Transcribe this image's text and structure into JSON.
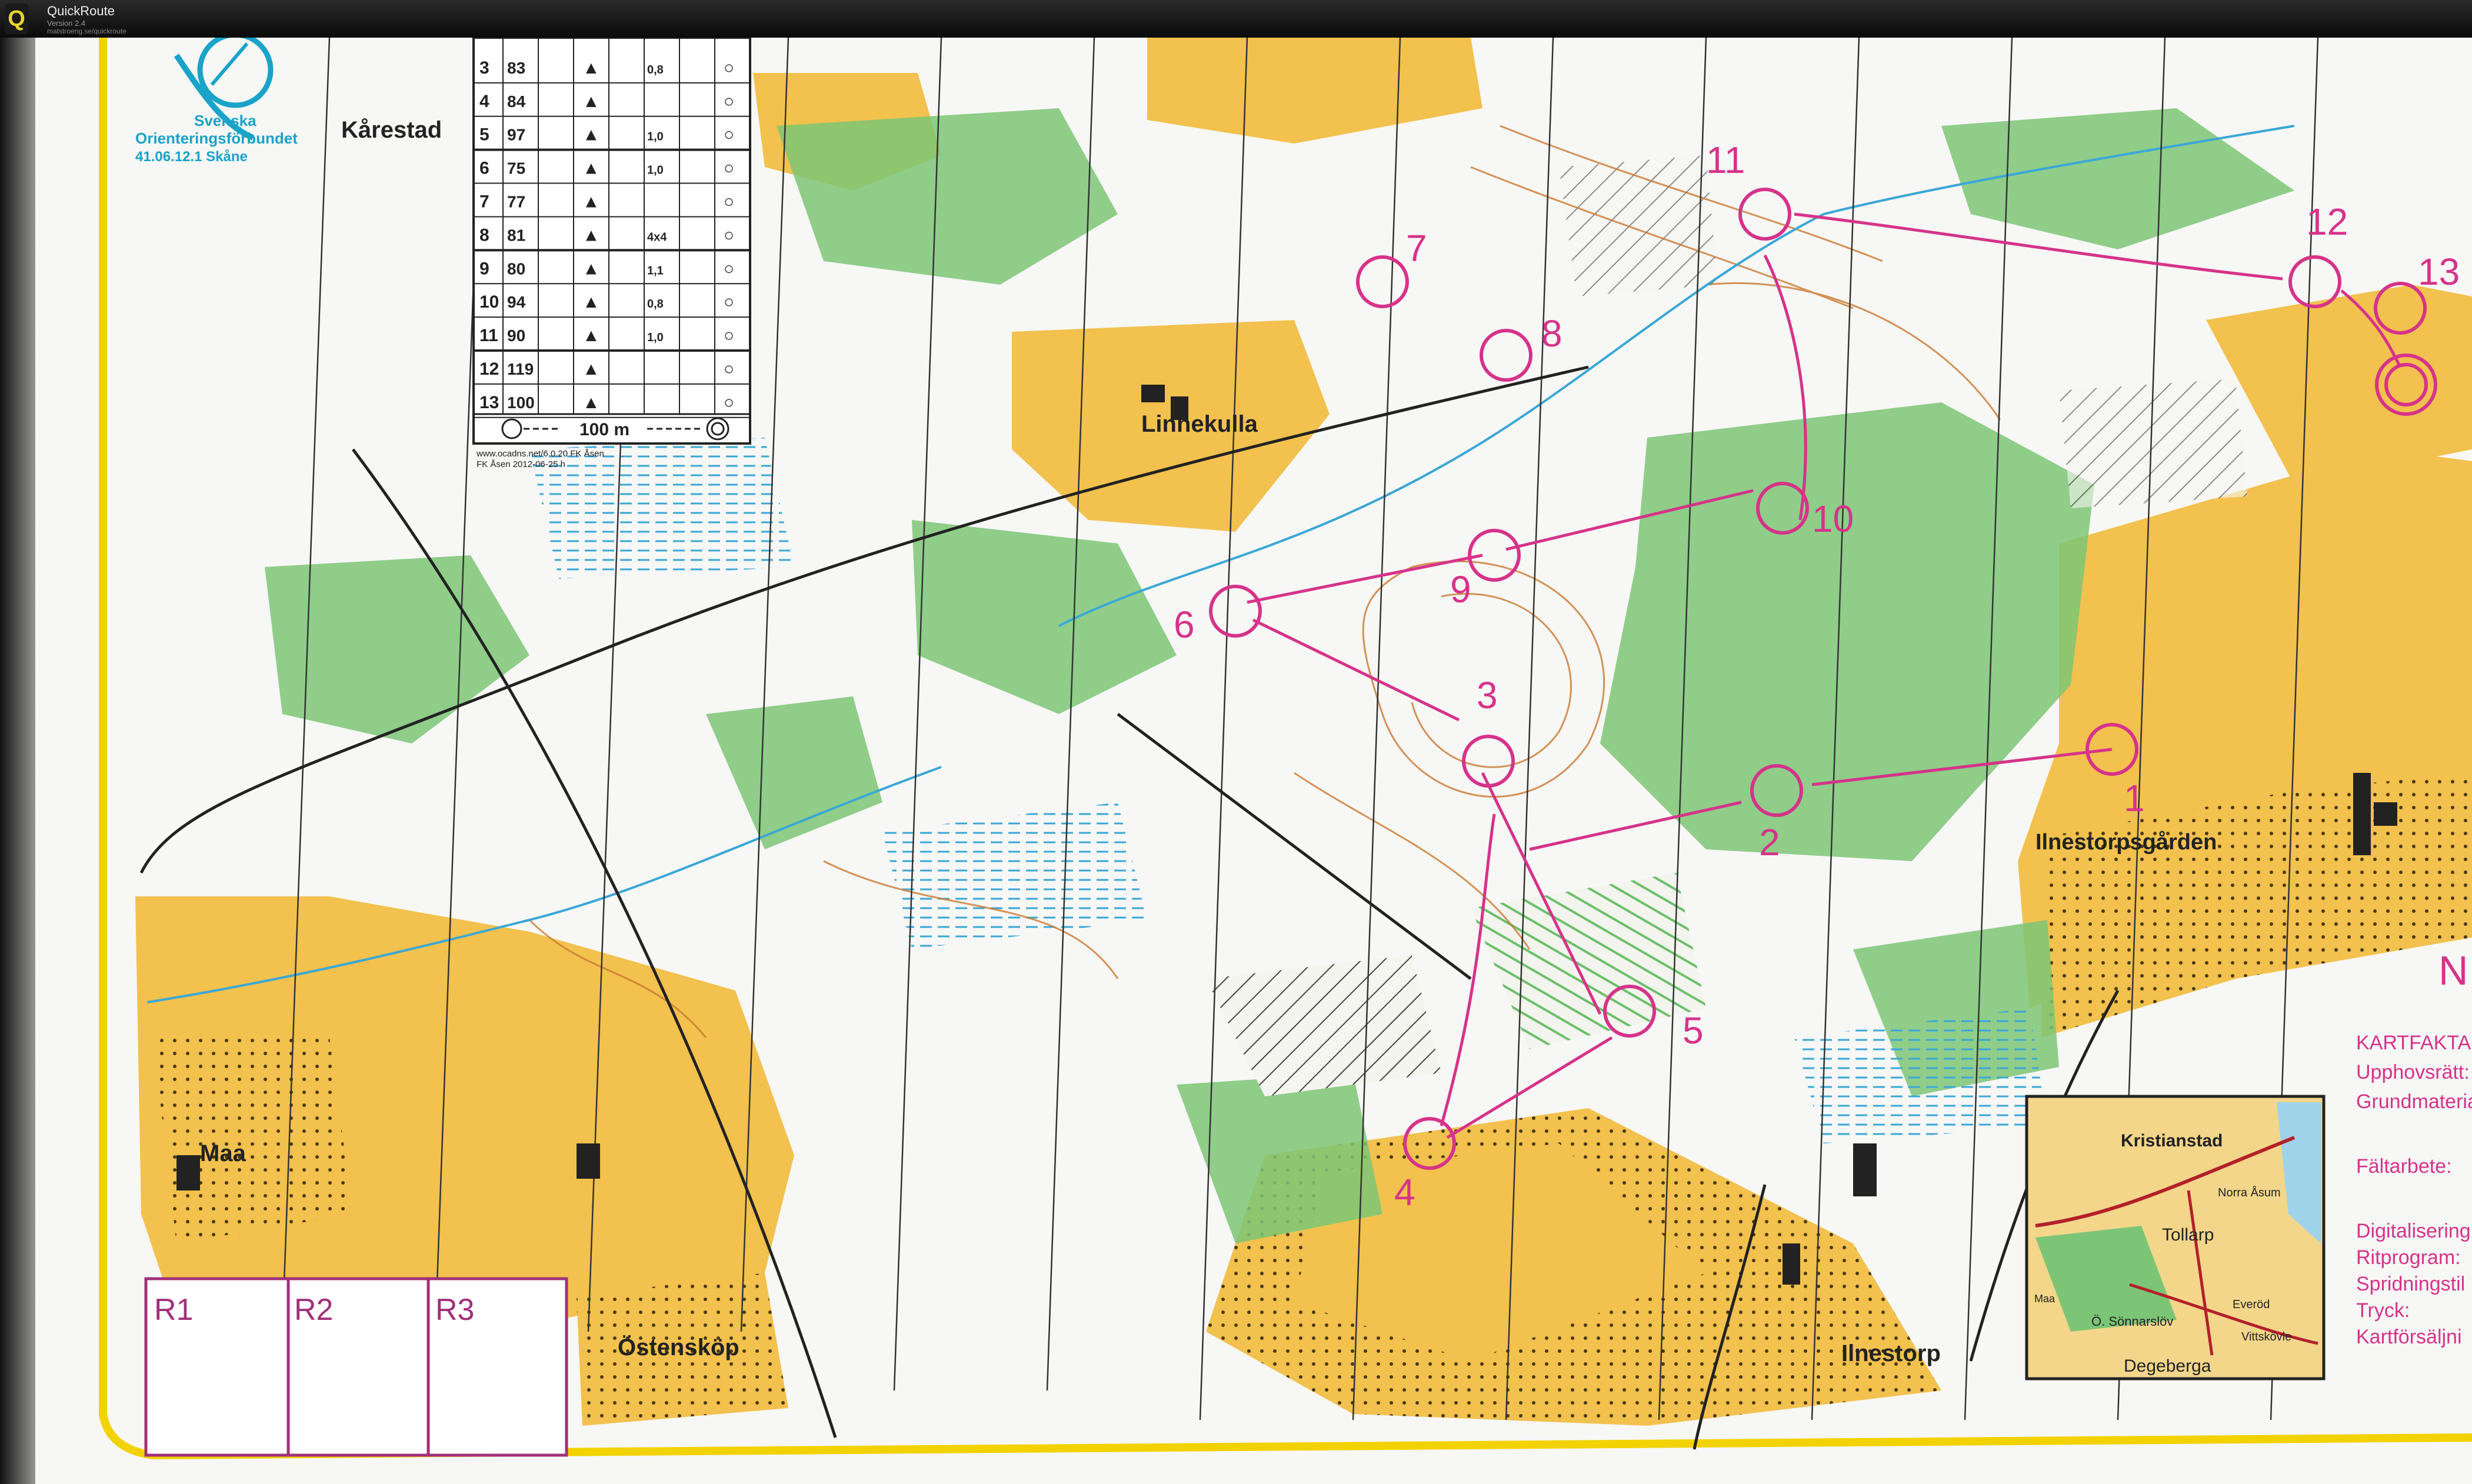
{
  "app": {
    "title": "QuickRoute",
    "version": "Version 2.4",
    "url": "matstroeng.se/quickroute",
    "icon": "quickroute-q-icon"
  },
  "map": {
    "logo": {
      "org_line1": "Svenska",
      "org_line2": "Orienteringsförbundet",
      "permit": "41.06.12.1 Skåne"
    },
    "place_names": {
      "karestad": "Kårestad",
      "linnekulla": "Linnekulla",
      "ilnestorpsgarden": "Ilnestorpsgården",
      "maa": "Maa",
      "ostenskop": "Östensköp",
      "ilnestorp": "Ilnestorp"
    },
    "control_table": {
      "rows": [
        {
          "n": "3",
          "code": "83",
          "size": "0,8"
        },
        {
          "n": "4",
          "code": "84",
          "size": ""
        },
        {
          "n": "5",
          "code": "97",
          "size": "1,0"
        },
        {
          "n": "6",
          "code": "75",
          "size": "1,0"
        },
        {
          "n": "7",
          "code": "77",
          "size": ""
        },
        {
          "n": "8",
          "code": "81",
          "size": "4x4"
        },
        {
          "n": "9",
          "code": "80",
          "size": "1,1"
        },
        {
          "n": "10",
          "code": "94",
          "size": "0,8"
        },
        {
          "n": "11",
          "code": "90",
          "size": "1,0"
        },
        {
          "n": "12",
          "code": "119",
          "size": ""
        },
        {
          "n": "13",
          "code": "100",
          "size": ""
        }
      ],
      "finish_distance": "100 m"
    },
    "credits_line1": "www.ocadns.net/6.0.20 FK Åsen",
    "credits_line2": "FK Åsen 2012-06-25 h",
    "controls": [
      "1",
      "2",
      "3",
      "4",
      "5",
      "6",
      "7",
      "8",
      "9",
      "10",
      "11",
      "12",
      "13"
    ],
    "relay_boxes": [
      "R1",
      "R2",
      "R3"
    ],
    "north_label": "N",
    "kartfakta": {
      "heading": "KARTFAKTA",
      "lines": [
        "Upphovsrätt:",
        "Grundmateria",
        "Fältarbete:",
        "Digitalisering",
        "Ritprogram:",
        "Spridningstil",
        "Tryck:",
        "Kartförsäljni"
      ]
    },
    "inset": {
      "kristianstad": "Kristianstad",
      "norra_asum": "Norra Åsum",
      "tollarp": "Tollarp",
      "maa": "Maa",
      "sonnarslov": "Ö. Sönnarslöv",
      "everod": "Everöd",
      "vittskovle": "Vittskövle",
      "degeberga": "Degeberga"
    },
    "colors": {
      "open_land": "#f2c14e",
      "forest_green": "#7cc576",
      "white_forest": "#f7f7f5",
      "course_magenta": "#d6338a",
      "contour_brown": "#c9782f",
      "border_yellow": "#f2d200"
    }
  }
}
